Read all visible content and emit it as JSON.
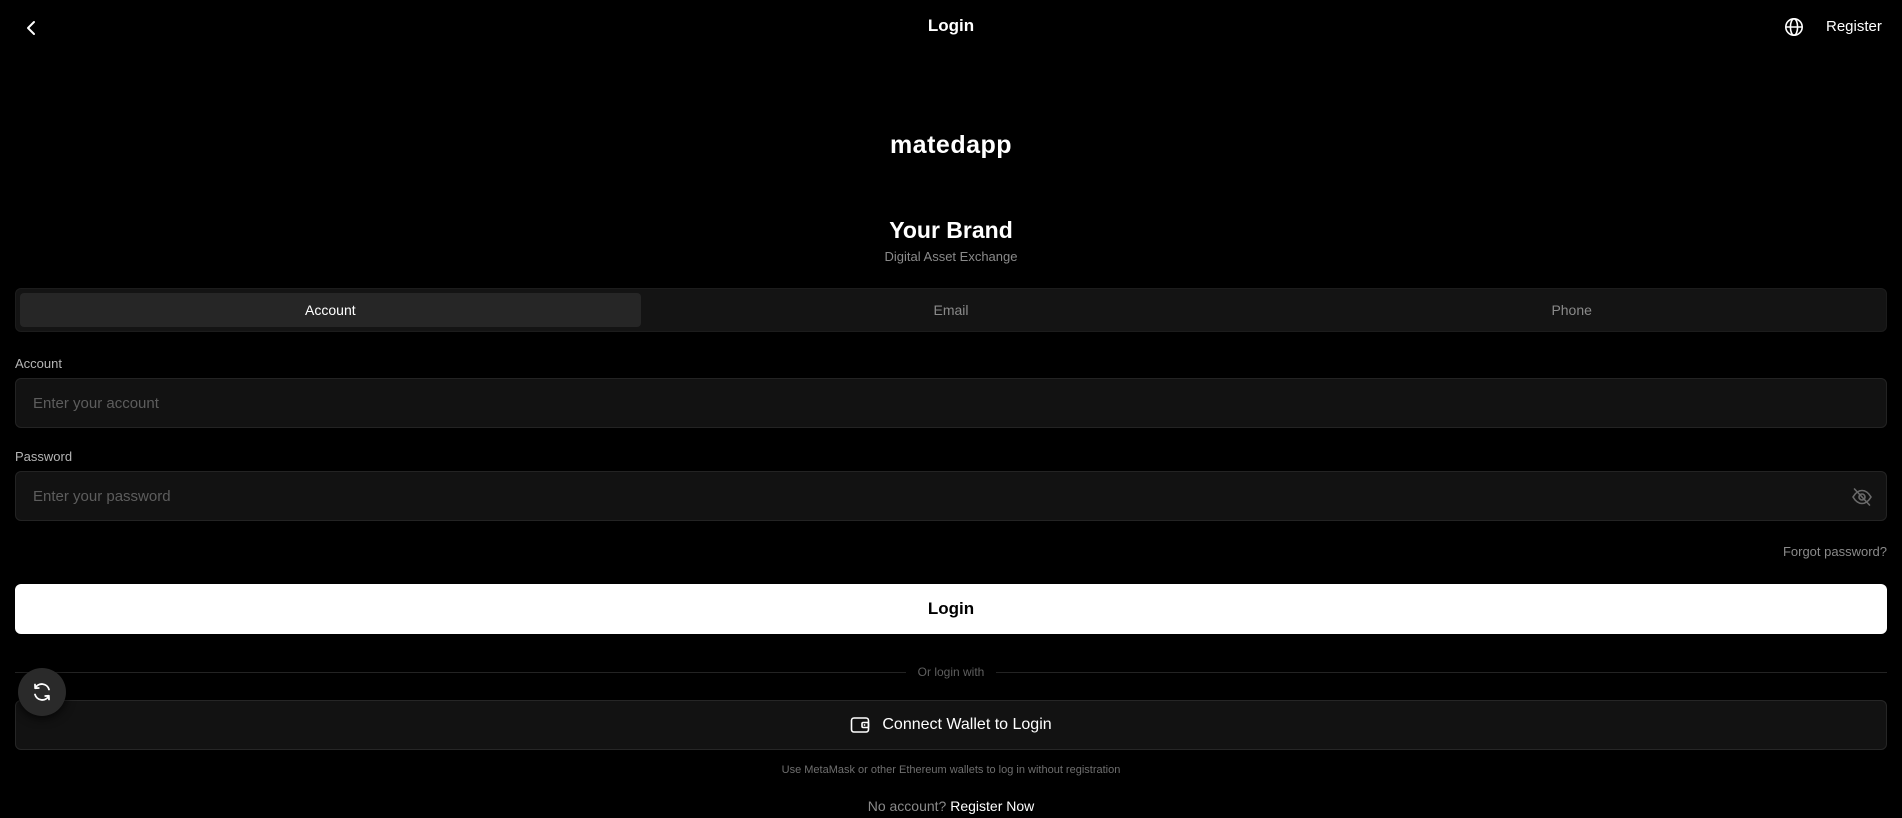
{
  "header": {
    "title": "Login",
    "register_label": "Register",
    "back_icon": "chevron-left-icon",
    "language_icon": "globe-icon"
  },
  "brand": {
    "logo_text": "matedapp",
    "name": "Your Brand",
    "tagline": "Digital Asset Exchange"
  },
  "tabs": [
    {
      "label": "Account",
      "active": true
    },
    {
      "label": "Email",
      "active": false
    },
    {
      "label": "Phone",
      "active": false
    }
  ],
  "form": {
    "account_label": "Account",
    "account_placeholder": "Enter your account",
    "account_value": "",
    "password_label": "Password",
    "password_placeholder": "Enter your password",
    "password_value": "",
    "password_toggle_icon": "eye-off-icon",
    "forgot_label": "Forgot password?",
    "login_button": "Login"
  },
  "alt_login": {
    "divider_text": "Or login with",
    "wallet_icon": "wallet-icon",
    "wallet_button": "Connect Wallet to Login",
    "wallet_hint": "Use MetaMask or other Ethereum wallets to log in without registration"
  },
  "footer": {
    "no_account_text": "No account?",
    "register_now": "Register Now"
  },
  "floating": {
    "refresh_icon": "refresh-icon"
  },
  "colors": {
    "background": "#000000",
    "surface": "#121212",
    "primary_button": "#ffffff",
    "muted_text": "#8a8a8a"
  }
}
